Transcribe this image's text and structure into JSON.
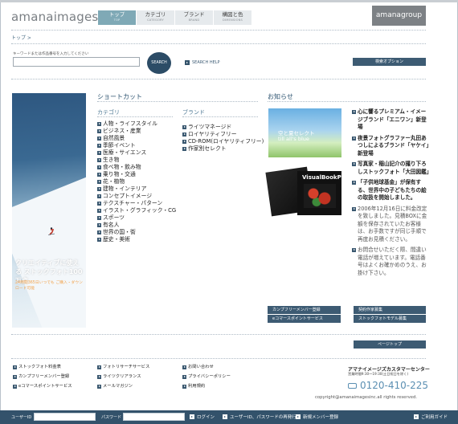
{
  "header": {
    "logo": "amanaimages",
    "group_logo": "amanagroup",
    "nav": [
      {
        "label": "トップ",
        "sub": "TOP"
      },
      {
        "label": "カテゴリ",
        "sub": "CATEGORY"
      },
      {
        "label": "ブランド",
        "sub": "BRAND"
      },
      {
        "label": "構図と色",
        "sub": "DIMENSIONS"
      }
    ]
  },
  "breadcrumb": "トップ >",
  "search": {
    "caption": "キーワードまたは作品番号を入力してください",
    "input_value": "",
    "button_label": "SEARCH",
    "help_label": "SEARCH HELP",
    "options_label": "検索オプション"
  },
  "banner": {
    "title": "クリエイティブに使える ストックフォト100万点",
    "subtitle": "24時間365日いつでも ご購入・ダウンロード可能"
  },
  "shortcut": {
    "title": "ショートカット",
    "category_title": "カテゴリ",
    "categories": [
      "人物・ライフスタイル",
      "ビジネス・産業",
      "自然風景",
      "季節イベント",
      "医療・サイエンス",
      "生き物",
      "食べ物・飲み物",
      "乗り物・交通",
      "花・植物",
      "建物・インテリア",
      "コンセプトイメージ",
      "テクスチャー・パターン",
      "イラスト・グラフィック・CG",
      "スポーツ",
      "有名人",
      "世界の国・街",
      "歴史・美術"
    ],
    "brand_title": "ブランド",
    "brands": [
      "ライツマネージド",
      "ロイヤリティフリー",
      "CD-ROM(ロイヤリティフリー)",
      "作家別セレクト"
    ]
  },
  "news": {
    "title": "お知らせ",
    "image1_line1": "空と夏セレクト",
    "image1_line2": "till all's blue",
    "image2_title": "VisualBookPro",
    "items": [
      {
        "text": "心に響るプレミアム・イメージブランド「エニワン」新登場",
        "style": "bold"
      },
      {
        "text": "夜景フォトグラファー丸田あつしによるブランド「ヤケイ」新登場",
        "style": "bold"
      },
      {
        "text": "写真家・稲山記介の撮り下ろしストックフォト「大田図鑑」",
        "style": "bold"
      },
      {
        "text": "「子供地球基金」が保有する、世界中の子どもたちの絵の取扱を開始しました。",
        "style": "bold"
      },
      {
        "text": "2006年12月16日に料金改定を致しました。見積BOXに金額を保存されていたお客様は、お手数ですが同じ手順で再度お見積ください。",
        "style": "plain"
      },
      {
        "text": "お問合せいただく際、間違い電話が増えています。電話番号はよくお確かめのうえ、お掛け下さい。",
        "style": "plain"
      }
    ]
  },
  "buttons": {
    "member_register": "カンプフリーメンバー登録",
    "ecommerce_service": "eコマースポイントサービス",
    "contract_recruit": "契約作家募集",
    "model_recruit": "ストックフォトモデル募集",
    "pagetop": "ページトップ"
  },
  "footer": {
    "col1": [
      "ストックフォト料金表",
      "カンプフリーメンバー登録",
      "eコマースポイントサービス"
    ],
    "col2": [
      "フォトリサーチサービス",
      "ライツクリアランス",
      "メールマガジン"
    ],
    "col3": [
      "お問い合わせ",
      "プライバシーポリシー",
      "利用規約"
    ],
    "support_title": "アマナイメージズカスタマーセンター",
    "support_hours": "営業時間9:30〜19:30(土日祝日を除く)",
    "phone": "0120-410-225",
    "copyright": "copyright@amanaimagesinc.all rights reserved."
  },
  "bottombar": {
    "user_id_label": "ユーザーID",
    "password_label": "パスワード",
    "login_label": "ログイン",
    "reissue_label": "ユーザーID、パスワードの再発行",
    "new_member_label": "新規メンバー登録",
    "guide_label": "ご利用ガイド",
    "user_id_value": "",
    "password_value": ""
  }
}
